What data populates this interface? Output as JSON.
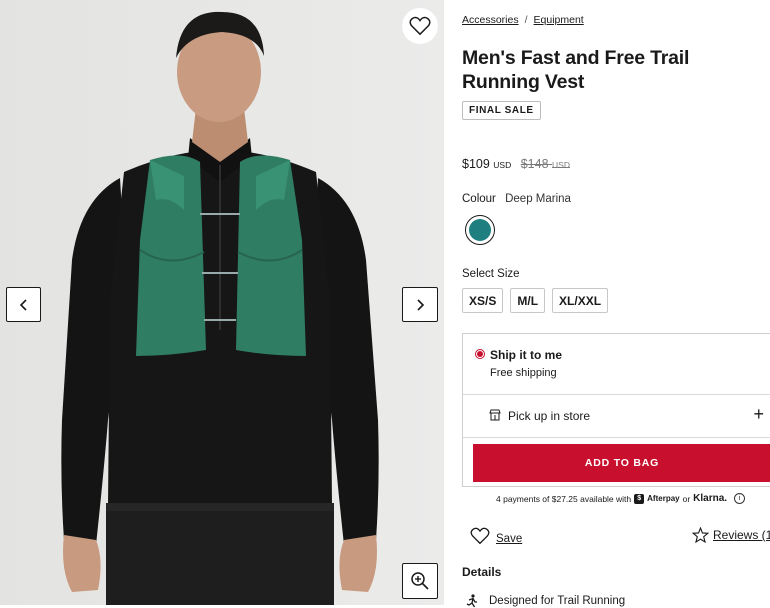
{
  "gallery": {
    "wishlist_icon": "heart-outline-icon",
    "prev_icon": "chevron-left-icon",
    "next_icon": "chevron-right-icon",
    "zoom_icon": "zoom-in-icon"
  },
  "breadcrumb": {
    "items": [
      "Accessories",
      "Equipment"
    ],
    "separator": "/"
  },
  "product": {
    "title": "Men's Fast and Free Trail Running Vest",
    "badge": "FINAL SALE",
    "price": "$109",
    "price_currency": "USD",
    "old_price": "$148",
    "old_currency": "USD",
    "colour_label": "Colour",
    "colour_value": "Deep Marina",
    "swatch_color": "#1f7f80",
    "size_label": "Select Size",
    "sizes": [
      "XS/S",
      "M/L",
      "XL/XXL"
    ]
  },
  "fulfilment": {
    "ship_title": "Ship it to me",
    "ship_sub": "Free shipping",
    "pickup_label": "Pick up in store",
    "expand_symbol": "+",
    "add_to_bag": "ADD TO BAG",
    "accent": "#c8102e"
  },
  "payment": {
    "text": "4 payments of $27.25 available with",
    "afterpay_mark": "$",
    "afterpay": "Afterpay",
    "or": "or",
    "klarna": "Klarna.",
    "info_icon": "i"
  },
  "actions": {
    "save": "Save",
    "reviews": "Reviews (1"
  },
  "details": {
    "heading": "Details",
    "first_item": "Designed for Trail Running"
  }
}
